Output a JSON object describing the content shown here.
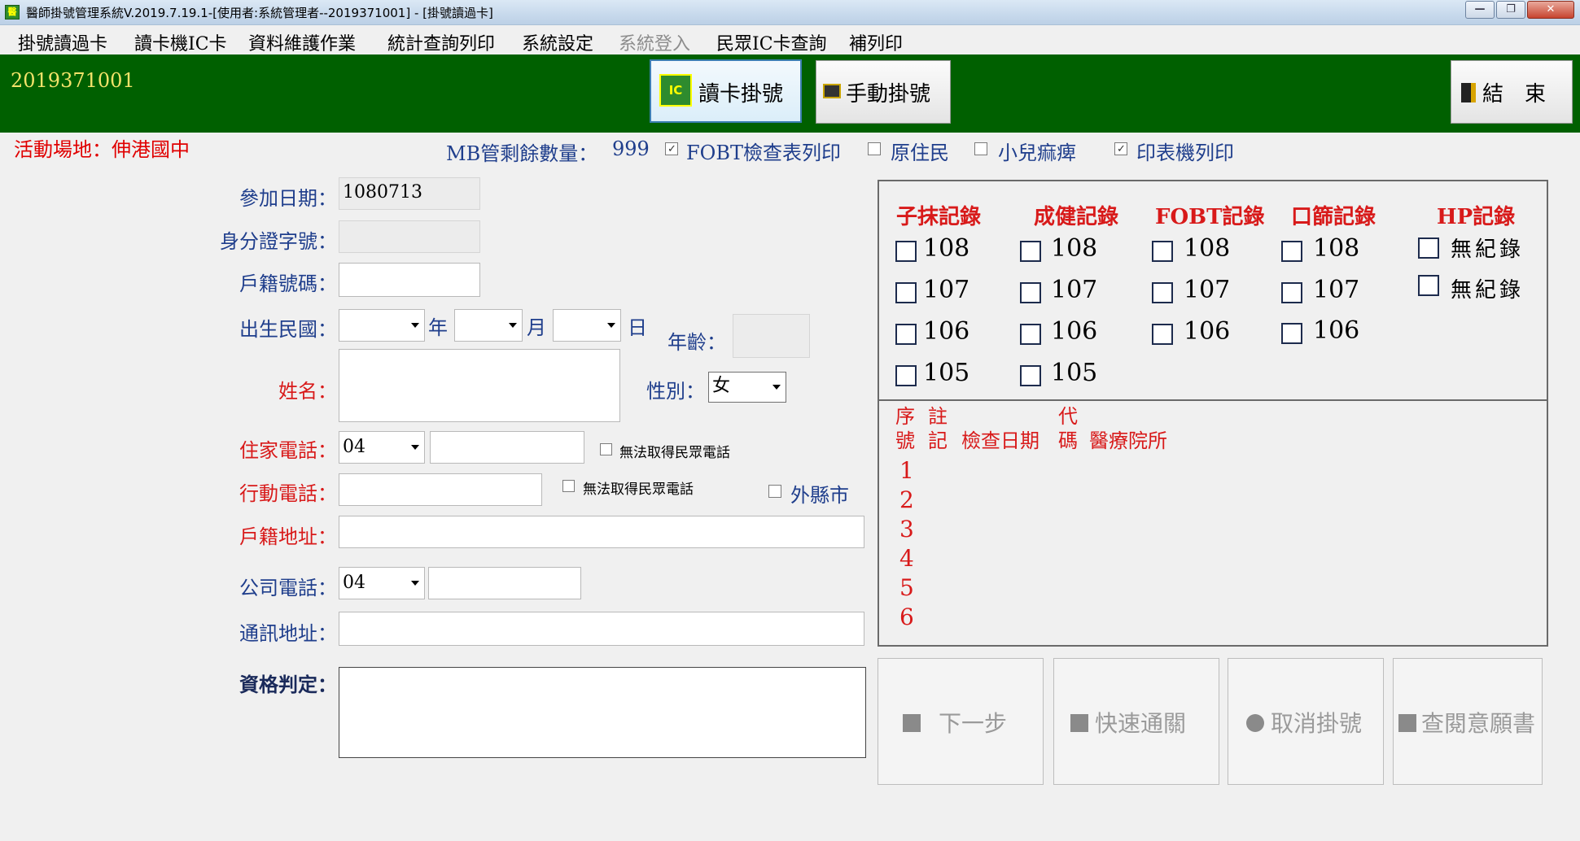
{
  "window": {
    "title": "醫師掛號管理系統V.2019.7.19.1-[使用者:系統管理者--2019371001] - [掛號讀過卡]",
    "icon_name": "app-icon",
    "controls": {
      "minimize": "—",
      "restore": "❐",
      "close": "✕"
    }
  },
  "menu": {
    "items": [
      "掛號讀過卡",
      "讀卡機IC卡",
      "資料維護作業",
      "統計查詢列印",
      "系統設定",
      "系統登入",
      "民眾IC卡查詢",
      "補列印"
    ],
    "disabled_item": "系統登入"
  },
  "toolbar": {
    "user_id": "2019371001",
    "read_card_label": "讀卡掛號",
    "read_card_icon_text": "IC",
    "manual_label": "手動掛號",
    "exit_label": "結　束",
    "background": "#006000"
  },
  "info": {
    "venue": "活動場地：伸港國中",
    "mb_remaining": "MB管剩餘數量：",
    "mb_value": "999",
    "opt_fobt": "FOBT檢查表列印",
    "opt_fobt_checked": true,
    "opt_aboriginal": "原住民",
    "opt_aboriginal_checked": false,
    "opt_polio": "小兒痲痺",
    "opt_polio_checked": false,
    "opt_printer": "印表機列印",
    "opt_printer_checked": true
  },
  "form": {
    "join_date_label": "參加日期：",
    "join_date_value": "1080713",
    "id_label": "身分證字號：",
    "id_value": "",
    "household_label": "戶籍號碼：",
    "birth_label": "出生民國：",
    "year_unit": "年",
    "month_unit": "月",
    "day_unit": "日",
    "age_label": "年齡：",
    "name_label": "姓名：",
    "gender_label": "性別：",
    "gender_value": "女",
    "home_phone_label": "住家電話：",
    "home_area_code": "04",
    "no_phone_label": "無法取得民眾電話",
    "mobile_label": "行動電話：",
    "no_mobile_label": "無法取得民眾電話",
    "out_of_county_label": "外縣市",
    "address_label": "戶籍地址：",
    "company_phone_label": "公司電話：",
    "company_area_code": "04",
    "mail_address_label": "通訊地址：",
    "qualification_label": "資格判定："
  },
  "records": {
    "headers": [
      "子抹記錄",
      "成健記錄",
      "FOBT記錄",
      "口篩記錄",
      "HP記錄"
    ],
    "pap_years": [
      "108",
      "107",
      "106",
      "105"
    ],
    "health_years": [
      "108",
      "107",
      "106",
      "105"
    ],
    "fobt_years": [
      "108",
      "107",
      "106"
    ],
    "oral_years": [
      "108",
      "107",
      "106"
    ],
    "hp_items": [
      "無紀錄",
      "無紀錄"
    ],
    "table_columns": {
      "seq_top": "序",
      "seq_bottom": "號",
      "note_top": "註",
      "note_bottom": "記",
      "date": "檢查日期",
      "code_top": "代",
      "code_bottom": "碼",
      "hospital": "醫療院所"
    },
    "rows": [
      "1",
      "2",
      "3",
      "4",
      "5",
      "6"
    ]
  },
  "actions": {
    "next_label": "下一步",
    "fast_pass_label": "快速通關",
    "cancel_label": "取消掛號",
    "consent_label": "查閱意願書"
  }
}
